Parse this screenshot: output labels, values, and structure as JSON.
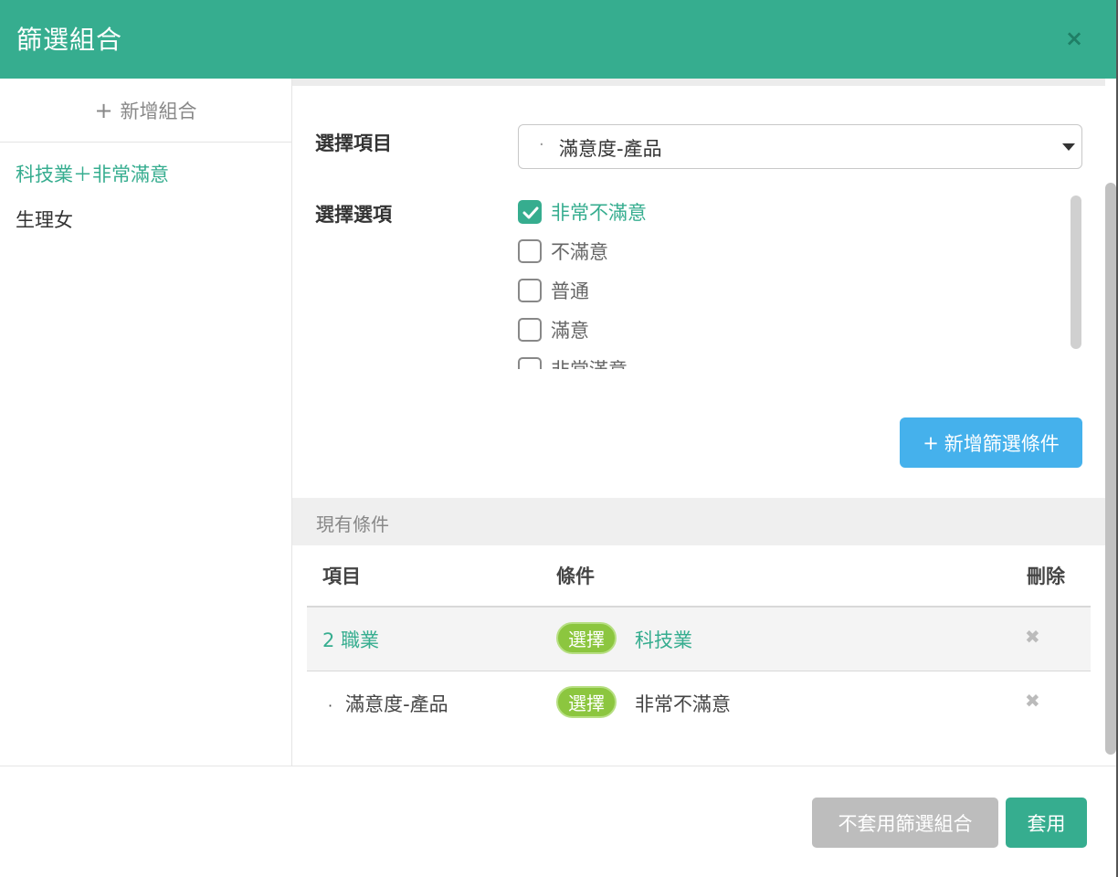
{
  "dialog": {
    "title": "篩選組合",
    "close_icon": "×"
  },
  "sidebar": {
    "add_label": "新增組合",
    "add_plus": "+",
    "items": [
      {
        "label": "科技業＋非常滿意"
      },
      {
        "label": "生理女"
      }
    ]
  },
  "form": {
    "item_label": "選擇項目",
    "item_dot": "·",
    "item_selected": "滿意度-產品",
    "option_label": "選擇選項",
    "options": [
      {
        "label": "非常不滿意",
        "checked": true
      },
      {
        "label": "不滿意",
        "checked": false
      },
      {
        "label": "普通",
        "checked": false
      },
      {
        "label": "滿意",
        "checked": false
      },
      {
        "label": "非常滿意",
        "checked": false
      }
    ],
    "add_condition_plus": "+",
    "add_condition_label": "新增篩選條件"
  },
  "conditions": {
    "heading": "現有條件",
    "columns": [
      "項目",
      "條件",
      "刪除"
    ],
    "rows": [
      {
        "item": "2 職業",
        "tag": "選擇",
        "value": "科技業",
        "delete": "✖"
      },
      {
        "item_dot": "·",
        "item": "滿意度-產品",
        "tag": "選擇",
        "value": "非常不滿意",
        "delete": "✖"
      }
    ]
  },
  "footer": {
    "no_apply_label": "不套用篩選組合",
    "apply_label": "套用"
  },
  "colors": {
    "accent": "#36ad8f",
    "blue_button": "#45b1ec",
    "tag": "#8cc63f",
    "disabled": "#bdbdbd"
  }
}
